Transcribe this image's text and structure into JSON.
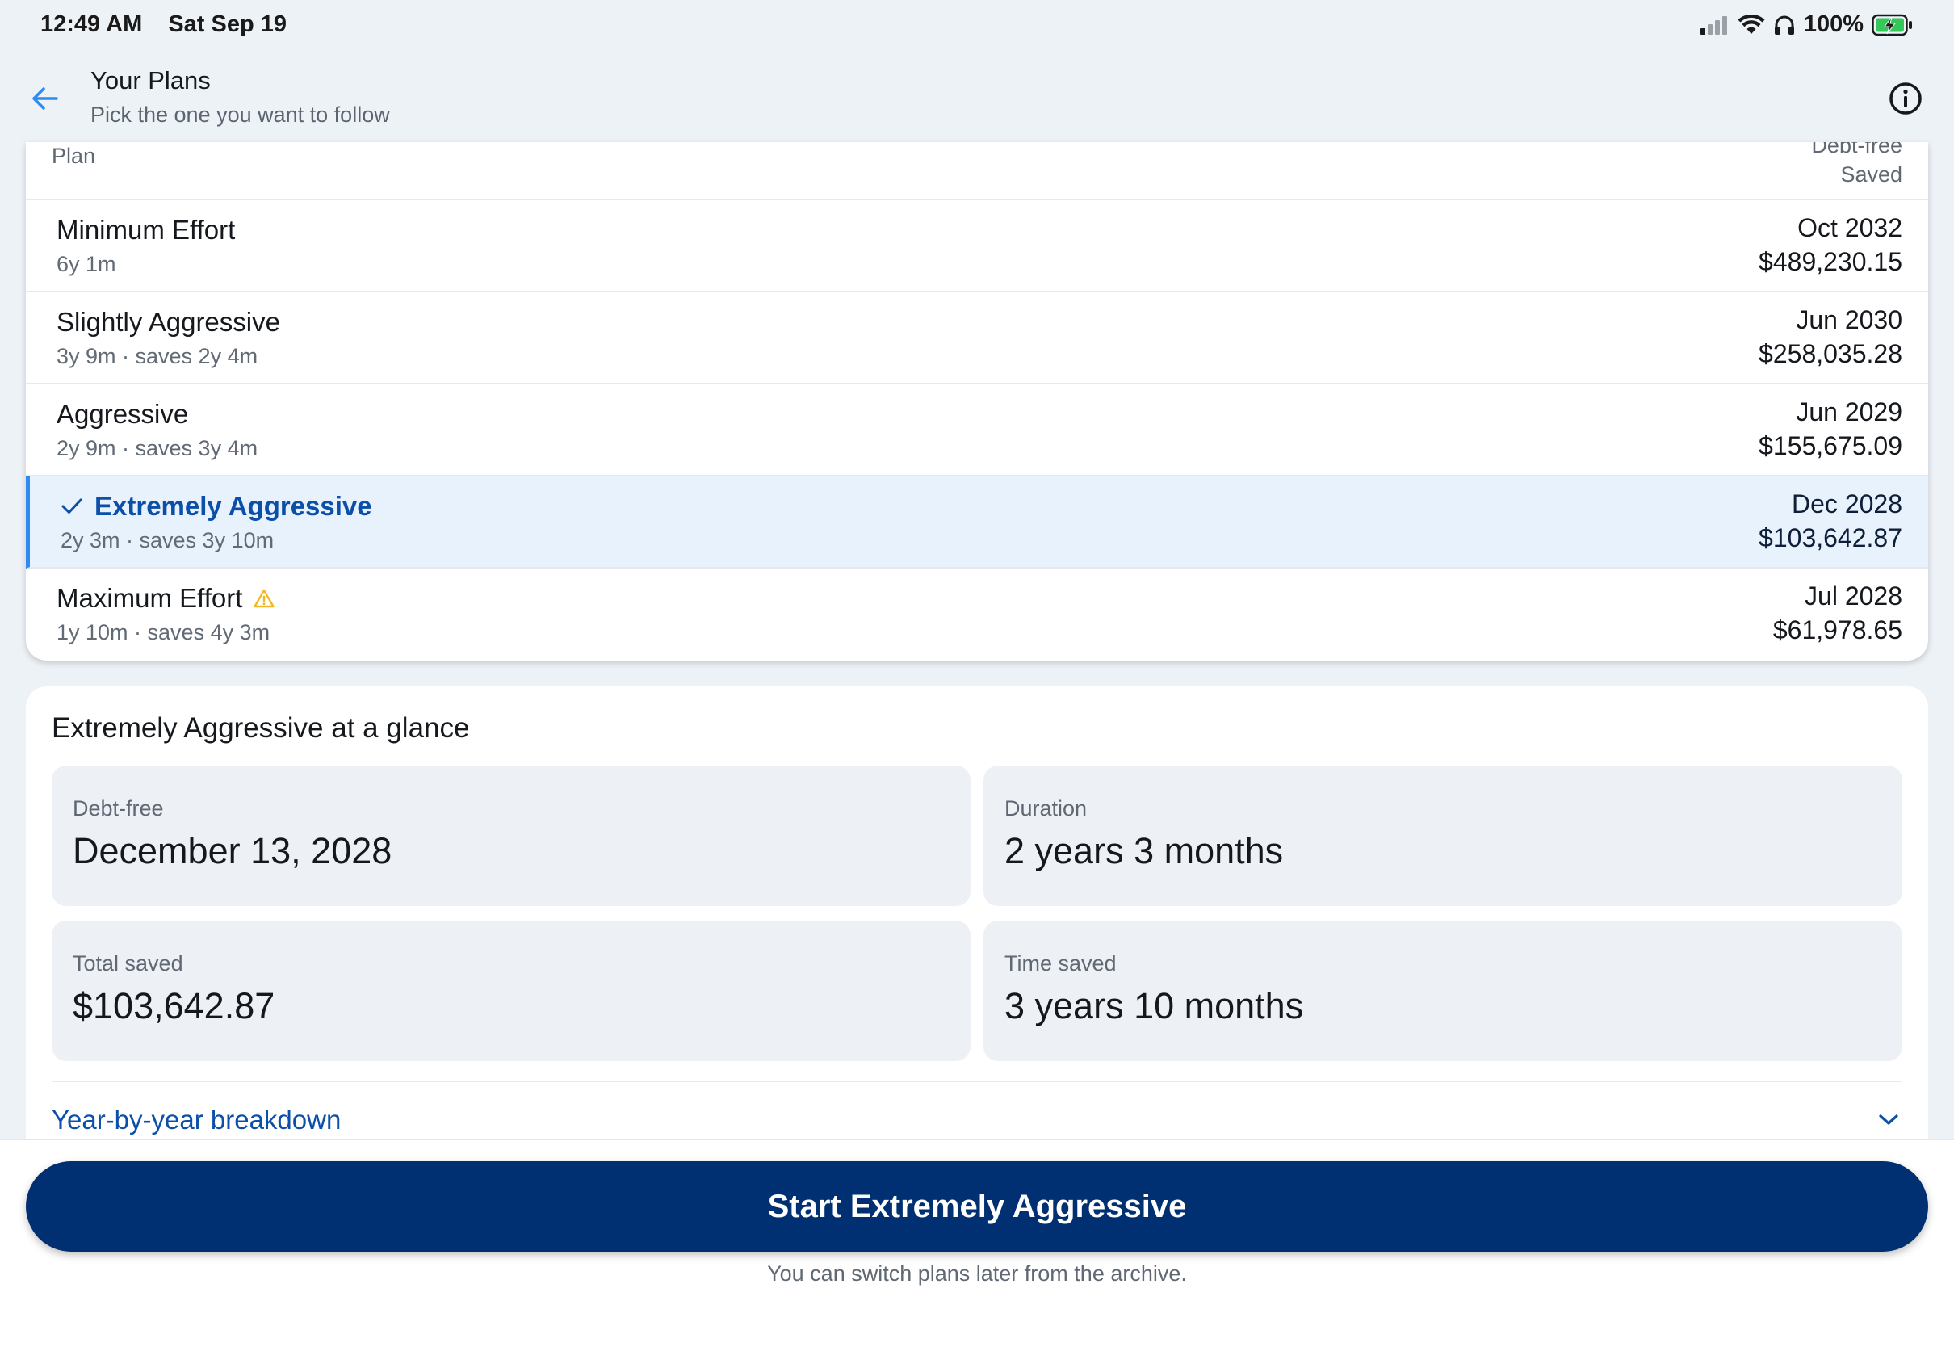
{
  "status_bar": {
    "time": "12:49 AM",
    "date": "Sat Sep 19",
    "battery": "100%",
    "icons": [
      "signal-icon",
      "wifi-icon",
      "headphones-icon",
      "battery-charging-icon"
    ]
  },
  "header": {
    "title": "Your Plans",
    "subtitle": "Pick the one you want to follow",
    "back_icon": "arrow-left-icon",
    "info_icon": "info-icon"
  },
  "plans_table": {
    "col_plan": "Plan",
    "col_right_top": "Debt-free",
    "col_right_bottom": "Saved",
    "rows": [
      {
        "name": "Minimum Effort",
        "sub": "6y 1m",
        "date": "Oct 2032",
        "amount": "$489,230.15",
        "selected": false,
        "warning": false
      },
      {
        "name": "Slightly Aggressive",
        "sub": "3y 9m · saves 2y 4m",
        "date": "Jun 2030",
        "amount": "$258,035.28",
        "selected": false,
        "warning": false
      },
      {
        "name": "Aggressive",
        "sub": "2y 9m · saves 3y 4m",
        "date": "Jun 2029",
        "amount": "$155,675.09",
        "selected": false,
        "warning": false
      },
      {
        "name": "Extremely Aggressive",
        "sub": "2y 3m · saves 3y 10m",
        "date": "Dec 2028",
        "amount": "$103,642.87",
        "selected": true,
        "warning": false
      },
      {
        "name": "Maximum Effort",
        "sub": "1y 10m · saves 4y 3m",
        "date": "Jul 2028",
        "amount": "$61,978.65",
        "selected": false,
        "warning": true
      }
    ]
  },
  "glance": {
    "title": "Extremely Aggressive at a glance",
    "debt_free": {
      "label": "Debt-free",
      "value": "December 13, 2028"
    },
    "duration": {
      "label": "Duration",
      "value": "2 years 3 months"
    },
    "total_saved": {
      "label": "Total saved",
      "value": "$103,642.87"
    },
    "time_saved": {
      "label": "Time saved",
      "value": "3 years 10 months"
    },
    "breakdown_label": "Year-by-year breakdown"
  },
  "footer": {
    "start_button": "Start Extremely Aggressive",
    "note": "You can switch plans later from the archive."
  },
  "colors": {
    "accent": "#0b4fa8",
    "primary_button": "#003072",
    "selected_row": "#e7f2fd",
    "selected_bar": "#2f8bef",
    "warning": "#f2b824",
    "background": "#edf2f7"
  }
}
